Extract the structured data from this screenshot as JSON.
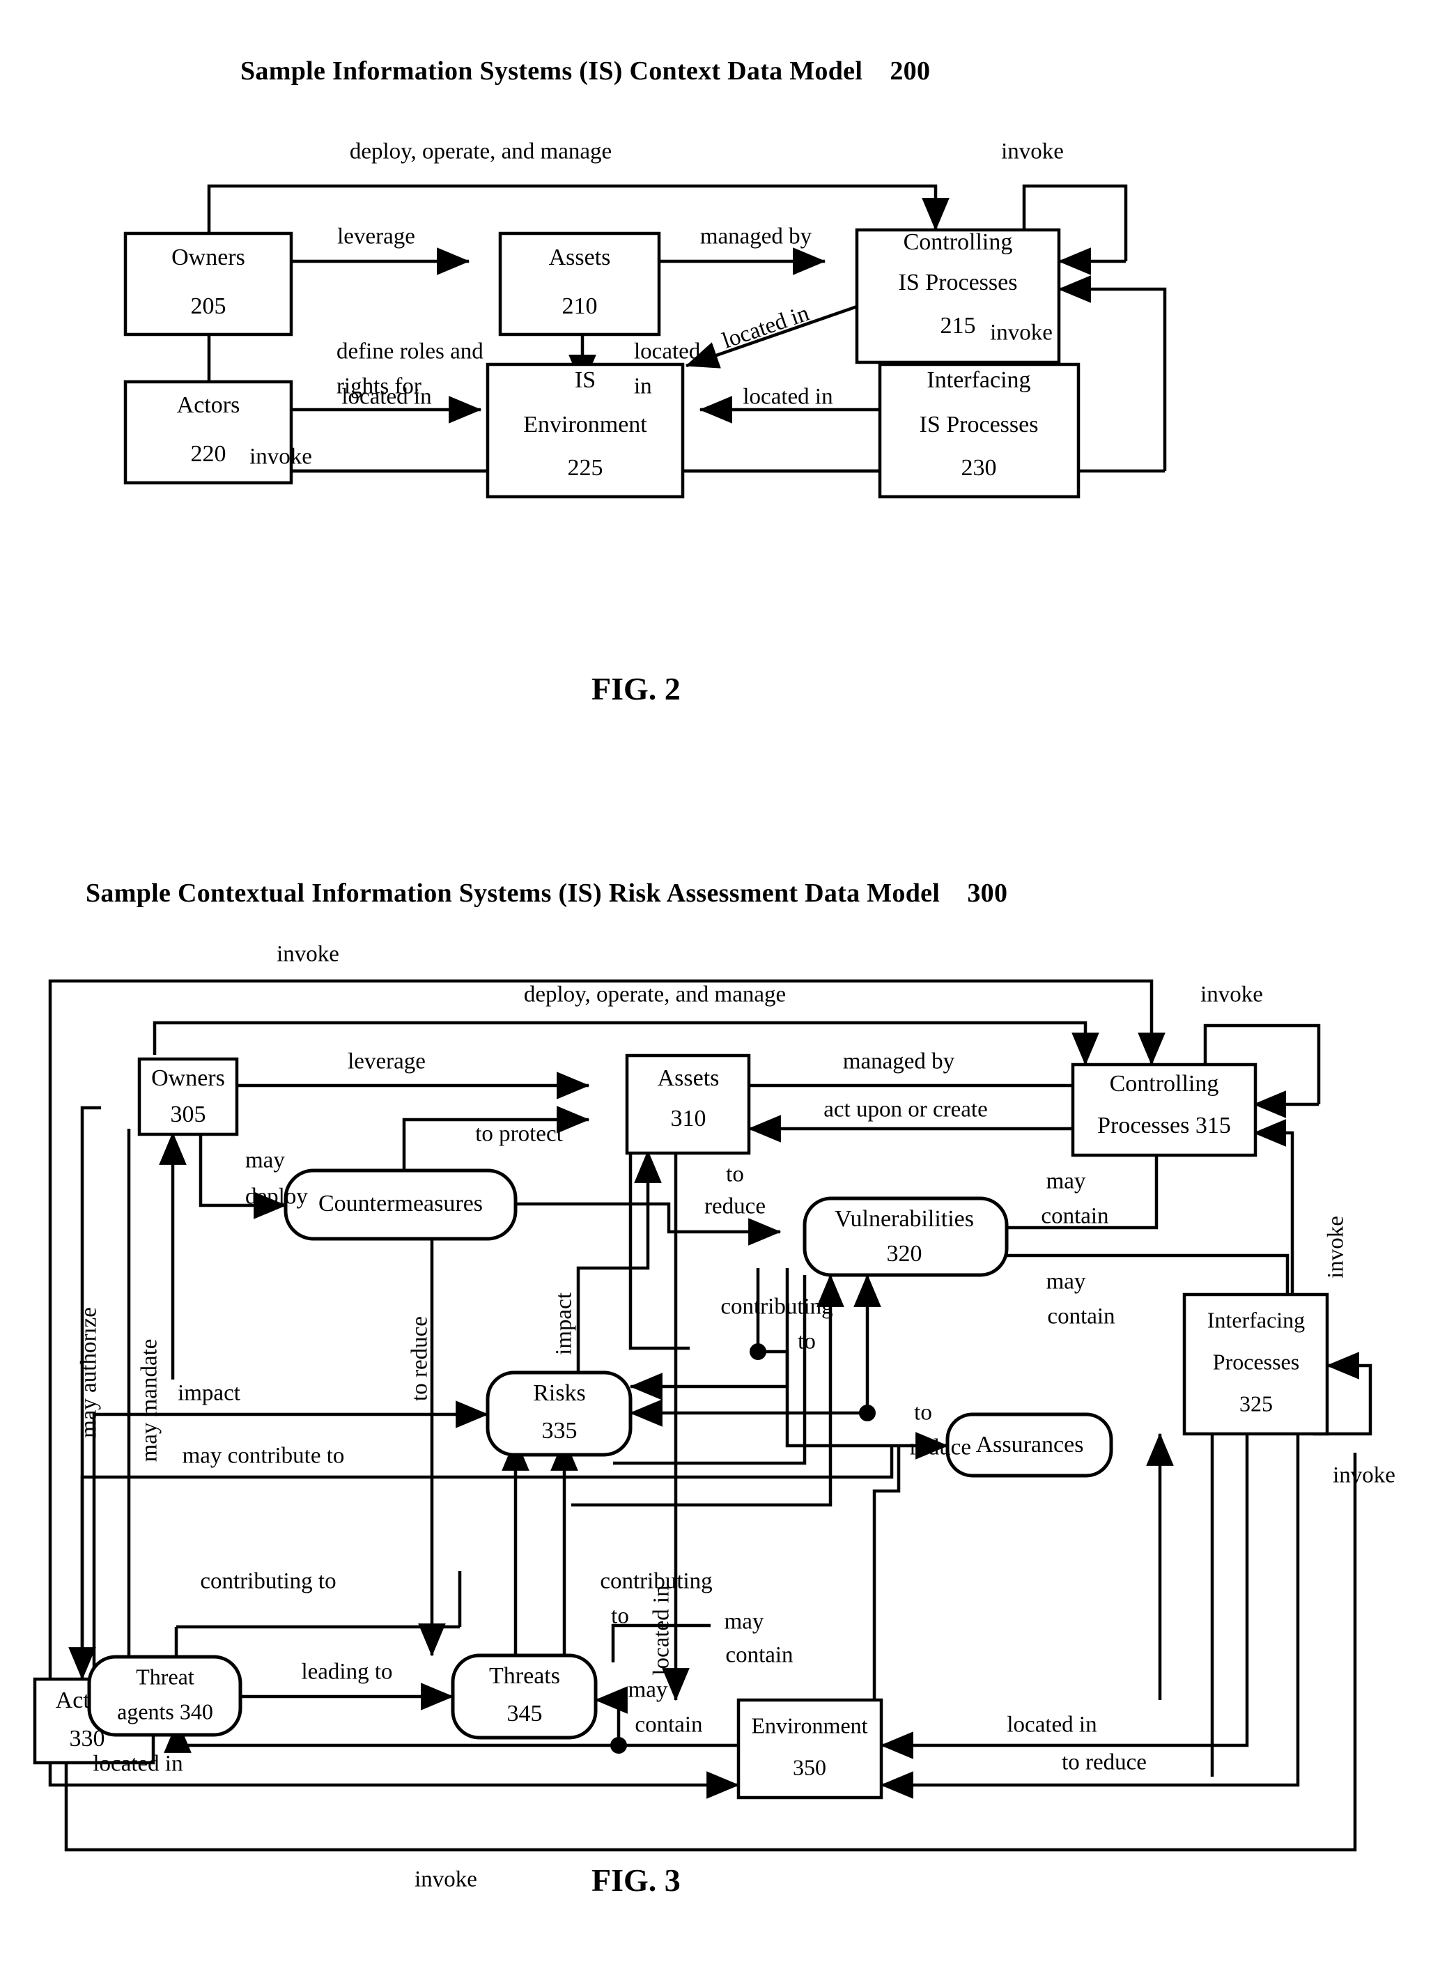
{
  "figure2": {
    "title": "Sample Information Systems (IS) Context Data Model    200",
    "caption": "FIG. 2",
    "nodes": [
      {
        "id": "owners",
        "line1": "Owners",
        "line2": "205"
      },
      {
        "id": "assets",
        "line1": "Assets",
        "line2": "210"
      },
      {
        "id": "controlling",
        "line1": "Controlling",
        "line2": "IS Processes",
        "line3": "215"
      },
      {
        "id": "actors",
        "line1": "Actors",
        "line2": "220"
      },
      {
        "id": "environment",
        "line1": "IS",
        "line2": "Environment",
        "line3": "225"
      },
      {
        "id": "interfacing",
        "line1": "Interfacing",
        "line2": "IS Processes",
        "line3": "230"
      }
    ],
    "edges": [
      {
        "id": "deploy-operate-manage",
        "label": "deploy, operate, and manage"
      },
      {
        "id": "invoke-controlling-self",
        "label": "invoke"
      },
      {
        "id": "owners-leverage-assets",
        "label": "leverage"
      },
      {
        "id": "assets-managed-by-controlling",
        "label": "managed by"
      },
      {
        "id": "assets-located-in-env",
        "label": "located\nin"
      },
      {
        "id": "controlling-located-in-env",
        "label": "located in"
      },
      {
        "id": "owners-define-roles",
        "label": "define roles and\nrights for"
      },
      {
        "id": "interfacing-invoke-controlling",
        "label": "invoke"
      },
      {
        "id": "actors-located-in-env",
        "label": "located in"
      },
      {
        "id": "interfacing-located-in-env",
        "label": "located in"
      },
      {
        "id": "actors-invoke",
        "label": "invoke"
      }
    ],
    "edge_labels": {
      "deploy_operate_manage": "deploy, operate, and manage",
      "invoke_top_right": "invoke",
      "leverage": "leverage",
      "managed_by": "managed by",
      "located_l1": "located",
      "located_l2": "in",
      "located_in_diag": "located in",
      "define_roles_l1": "define roles and",
      "define_roles_l2": "rights for",
      "invoke_mid": "invoke",
      "located_in_actors": "located in",
      "located_in_interfacing": "located in",
      "invoke_bottom": "invoke"
    }
  },
  "figure3": {
    "title": "Sample Contextual Information Systems (IS) Risk Assessment Data Model    300",
    "caption": "FIG. 3",
    "nodes": [
      {
        "id": "owners",
        "line1": "Owners",
        "line2": "305",
        "shape": "rect"
      },
      {
        "id": "assets",
        "line1": "Assets",
        "line2": "310",
        "shape": "rect"
      },
      {
        "id": "controlling",
        "line1": "Controlling",
        "line2": "Processes 315",
        "shape": "rect"
      },
      {
        "id": "interfacing",
        "line1": "Interfacing",
        "line2": "Processes",
        "line3": "325",
        "shape": "rect"
      },
      {
        "id": "actors",
        "line1": "Actors",
        "line2": "330",
        "shape": "rect"
      },
      {
        "id": "environment",
        "line1": "Environment",
        "line2": "350",
        "shape": "rect"
      },
      {
        "id": "countermeasures",
        "line1": "Countermeasures",
        "shape": "round"
      },
      {
        "id": "vulnerabilities",
        "line1": "Vulnerabilities",
        "line2": "320",
        "shape": "round"
      },
      {
        "id": "risks",
        "line1": "Risks",
        "line2": "335",
        "shape": "round"
      },
      {
        "id": "assurances",
        "line1": "Assurances",
        "shape": "round"
      },
      {
        "id": "threat_agents",
        "line1": "Threat",
        "line2": "agents 340",
        "shape": "round"
      },
      {
        "id": "threats",
        "line1": "Threats",
        "line2": "345",
        "shape": "round"
      }
    ],
    "edge_labels": {
      "invoke_top": "invoke",
      "deploy_operate_manage": "deploy, operate, and manage",
      "invoke_top_right": "invoke",
      "leverage": "leverage",
      "managed_by": "managed by",
      "act_upon_or_create": "act upon or create",
      "to_protect": "to protect",
      "may_authorize": "may authorize",
      "may_mandate": "may mandate",
      "may_l1": "may",
      "deploy_l2": "deploy",
      "to_reduce_vert": "to reduce",
      "impact_vert": "impact",
      "impact_h": "impact",
      "to_l1": "to",
      "reduce_l2": "reduce",
      "may_contain_1_l1": "may",
      "may_contain_1_l2": "contain",
      "may_contain_2_l1": "may",
      "may_contain_2_l2": "contain",
      "invoke_right_vert": "invoke",
      "invoke_right_bottom": "invoke",
      "contributing_l1": "contributing",
      "contributing_l2": "to",
      "to_reduce_2_l1": "to",
      "to_reduce_2_l2": "reduce",
      "may_contribute_to": "may contribute to",
      "contributing_to_left": "contributing to",
      "contributing_right_l1": "contributing",
      "contributing_right_l2": "to",
      "leading_to": "leading to",
      "located_in_vert": "located in",
      "may_contain_3_l1": "may",
      "may_contain_3_l2": "contain",
      "may_contain_4_l1": "may",
      "may_contain_4_l2": "contain",
      "located_in_bottom_left": "located in",
      "located_in_right": "located in",
      "to_reduce_bottom": "to reduce",
      "invoke_bottom": "invoke"
    }
  },
  "colors": {
    "line": "#000000",
    "fill": "#ffffff",
    "text": "#000000"
  }
}
